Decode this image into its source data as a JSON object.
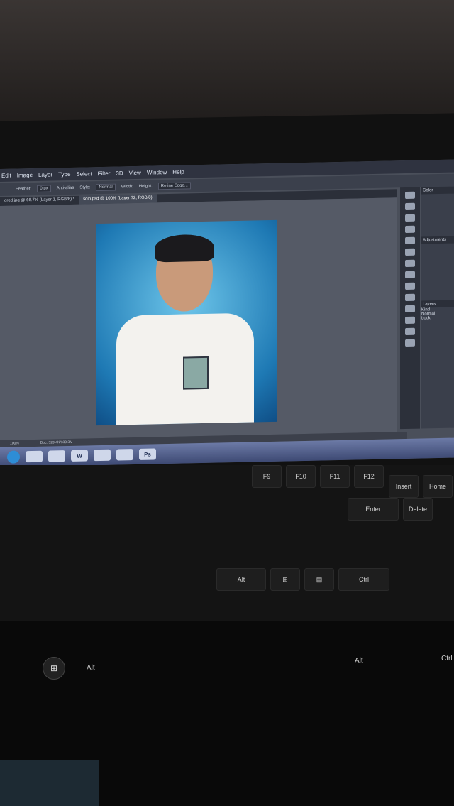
{
  "menu": [
    "Edit",
    "Image",
    "Layer",
    "Type",
    "Select",
    "Filter",
    "3D",
    "View",
    "Window",
    "Help"
  ],
  "options": {
    "feather_label": "Feather:",
    "feather_value": "0 px",
    "antialias_label": "Anti-alias",
    "style_label": "Style:",
    "style_value": "Normal",
    "width_label": "Width:",
    "height_label": "Height:",
    "refine": "Refine Edge..."
  },
  "tabs": [
    {
      "label": "ored.jpg @ 66.7% (Layer 1, RGB/8) *"
    },
    {
      "label": "solo.psd @ 100% (Layer 72, RGB/8)"
    }
  ],
  "panels": {
    "color": "Color",
    "adjustments": "Adjustments",
    "layers": "Layers",
    "kind": "Kind",
    "normal": "Normal",
    "lock": "Lock"
  },
  "status": {
    "zoom": "100%",
    "doc": "Doc: 329.4K/330.3M"
  },
  "taskbar": [
    "W",
    "Ps"
  ],
  "keys": {
    "row1": [
      "F9",
      "F10",
      "F11",
      "F12",
      "Insert",
      "Home"
    ],
    "row2": [
      "Enter",
      "Delete"
    ],
    "row3": [
      "Alt",
      "Ctrl"
    ],
    "deck": [
      "Alt",
      "Alt",
      "Ctrl"
    ]
  },
  "colors": {
    "screen": "#4a4f5a",
    "photo_bg": "#1e79b4",
    "taskbar": "#3e4a74"
  }
}
